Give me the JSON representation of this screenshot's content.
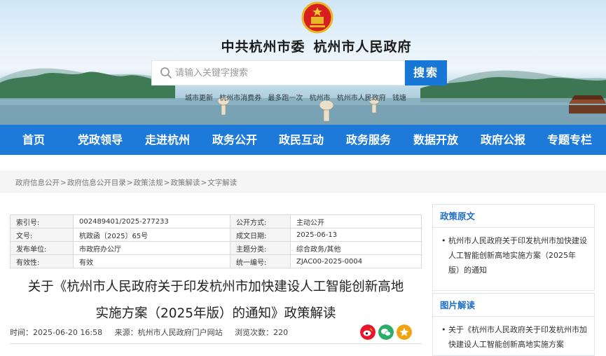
{
  "header": {
    "title_left": "中共杭州市委",
    "title_right": "杭州市人民政府",
    "search_placeholder": "请输入关键字搜索",
    "search_button": "搜索",
    "hot_words": [
      "城市更新",
      "杭州市消费券",
      "最多跑一次",
      "杭州市",
      "杭州市人民政府",
      "钱塘"
    ]
  },
  "nav": [
    "首页",
    "党政领导",
    "走进杭州",
    "政务公开",
    "政民互动",
    "政务服务",
    "数据开放",
    "政府公报",
    "专题专栏"
  ],
  "breadcrumb": [
    "政府信息公开",
    "政府信息公开目录",
    "政策法规",
    "政策解读",
    "文字解读"
  ],
  "meta": {
    "rows": [
      [
        "索引号:",
        "002489401/2025-277233",
        "公开方式:",
        "主动公开"
      ],
      [
        "文号:",
        "杭政函〔2025〕65号",
        "成文日期:",
        "2025-06-13"
      ],
      [
        "发布单位:",
        "市政府办公厅",
        "主题分类:",
        "综合政务/其他"
      ],
      [
        "有效性:",
        "有效",
        "统一编号:",
        "ZJAC00-2025-0004"
      ]
    ]
  },
  "article": {
    "title_line1": "关于《杭州市人民政府关于印发杭州市加快建设人工智能创新高地",
    "title_line2": "实施方案（2025年版）的通知》政策解读",
    "time": "时间：2025-06-20 16:58",
    "source": "来源：杭州市人民政府门户网站",
    "views": "浏览次数：220"
  },
  "sidebar": {
    "policy_heading": "政策原文",
    "policy_link": "杭州市人民政府关于印发杭州市加快建设人工智能创新高地实施方案（2025年版）的通知",
    "image_heading": "图片解读",
    "image_link": "关于《杭州市人民政府关于印发杭州市加快建设人工智能创新高地实施方案"
  },
  "colors": {
    "nav_bg": "#1e7ad8",
    "accent": "#1e6fc6",
    "weibo": "#e6162d",
    "wechat": "#2aae67",
    "star": "#f2a20c"
  },
  "icons": [
    "national-emblem-icon",
    "search-icon",
    "weibo-share-icon",
    "wechat-share-icon",
    "favorite-share-icon"
  ]
}
